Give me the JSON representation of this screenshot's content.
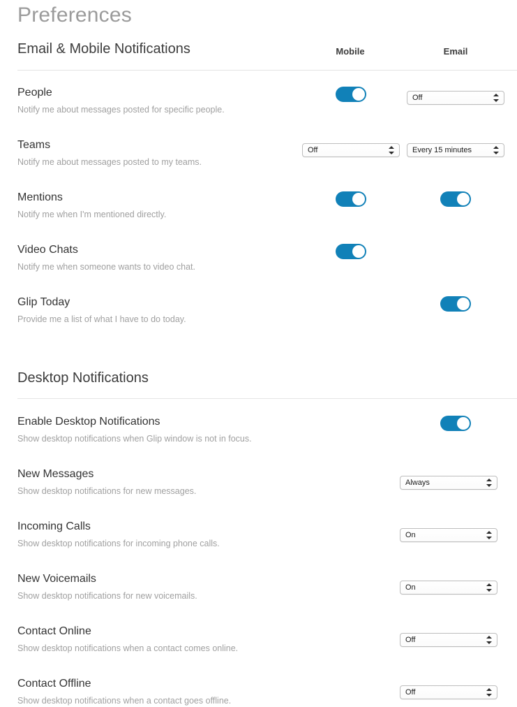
{
  "page": {
    "title": "Preferences"
  },
  "columns": {
    "mobile": "Mobile",
    "email": "Email"
  },
  "colors": {
    "toggle_on": "#1181b8",
    "toggle_off": "#d4d4d4",
    "title": "#9b9b9b",
    "label": "#333333",
    "description": "#a0a0a0",
    "divider": "#e4e4e4"
  },
  "sections": [
    {
      "heading": "Email & Mobile Notifications",
      "rows": [
        {
          "label": "People",
          "description": "Notify me about messages posted for specific people.",
          "mobile": {
            "type": "toggle",
            "state": "on"
          },
          "email": {
            "type": "select",
            "value": "Off"
          }
        },
        {
          "label": "Teams",
          "description": "Notify me about messages posted to my teams.",
          "mobile": {
            "type": "select",
            "value": "Off"
          },
          "email": {
            "type": "select",
            "value": "Every 15 minutes"
          }
        },
        {
          "label": "Mentions",
          "description": "Notify me when I'm mentioned directly.",
          "mobile": {
            "type": "toggle",
            "state": "on"
          },
          "email": {
            "type": "toggle",
            "state": "on"
          }
        },
        {
          "label": "Video Chats",
          "description": "Notify me when someone wants to video chat.",
          "mobile": {
            "type": "toggle",
            "state": "on"
          },
          "email": {
            "type": "none"
          }
        },
        {
          "label": "Glip Today",
          "description": "Provide me a list of what I have to do today.",
          "mobile": {
            "type": "none"
          },
          "email": {
            "type": "toggle",
            "state": "on"
          }
        }
      ]
    },
    {
      "heading": "Desktop Notifications",
      "rows": [
        {
          "label": "Enable Desktop Notifications",
          "description": "Show desktop notifications when Glip window is not in focus.",
          "control": {
            "type": "toggle",
            "state": "on"
          }
        },
        {
          "label": "New Messages",
          "description": "Show desktop notifications for new messages.",
          "control": {
            "type": "select",
            "value": "Always"
          }
        },
        {
          "label": "Incoming Calls",
          "description": "Show desktop notifications for incoming phone calls.",
          "control": {
            "type": "select",
            "value": "On"
          }
        },
        {
          "label": "New Voicemails",
          "description": "Show desktop notifications for new voicemails.",
          "control": {
            "type": "select",
            "value": "On"
          }
        },
        {
          "label": "Contact Online",
          "description": "Show desktop notifications when a contact comes online.",
          "control": {
            "type": "select",
            "value": "Off"
          }
        },
        {
          "label": "Contact Offline",
          "description": "Show desktop notifications when a contact goes offline.",
          "control": {
            "type": "select",
            "value": "Off"
          }
        }
      ]
    }
  ]
}
